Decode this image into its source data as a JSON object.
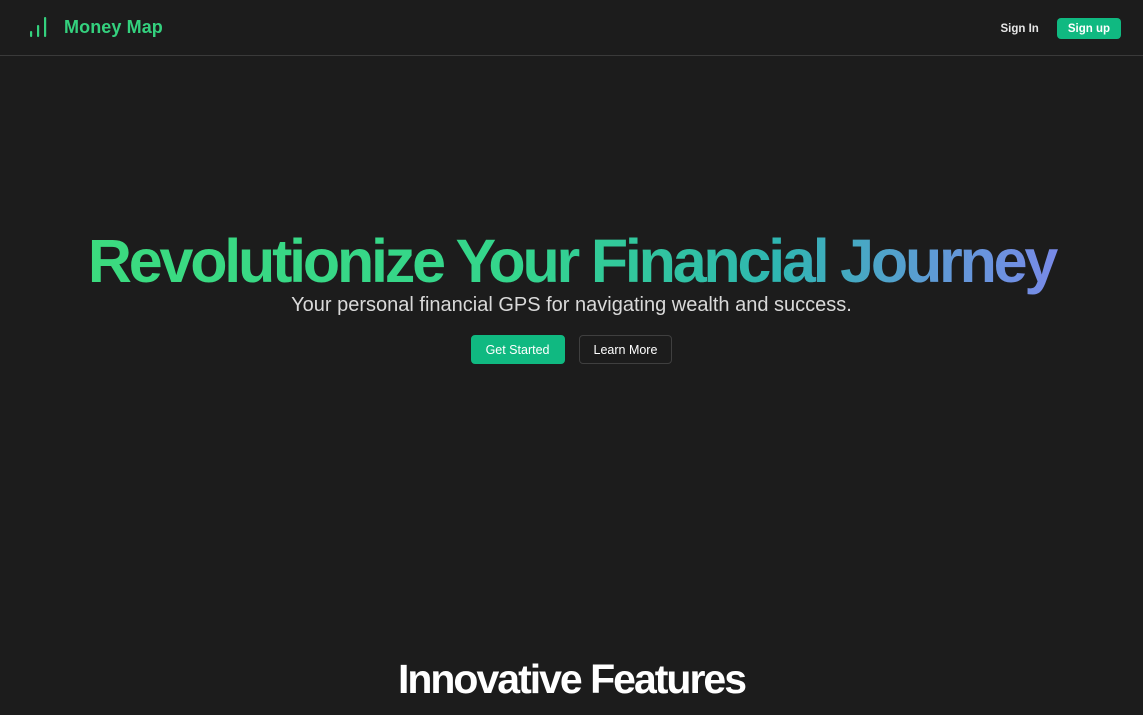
{
  "navbar": {
    "brand_name": "Money Map",
    "brand_icon": "bar-chart-icon",
    "signin_label": "Sign In",
    "signup_label": "Sign up"
  },
  "hero": {
    "title": "Revolutionize Your Financial Journey",
    "subtitle": "Your personal financial GPS for navigating wealth and success.",
    "primary_cta": "Get Started",
    "secondary_cta": "Learn More"
  },
  "features": {
    "heading": "Innovative Features"
  },
  "colors": {
    "background": "#1c1c1c",
    "accent": "#10b981",
    "brand_text": "#34d17e",
    "gradient_start": "#3ddc7c",
    "gradient_end": "#8b7ff5"
  }
}
